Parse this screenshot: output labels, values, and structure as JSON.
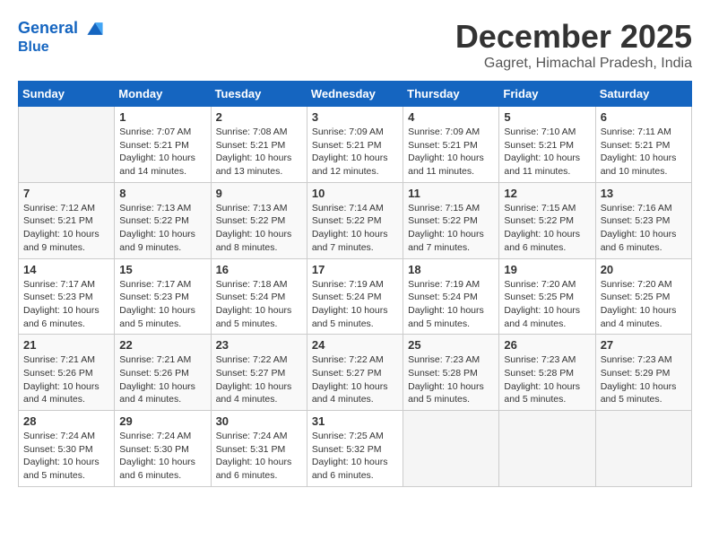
{
  "header": {
    "logo_line1": "General",
    "logo_line2": "Blue",
    "month": "December 2025",
    "location": "Gagret, Himachal Pradesh, India"
  },
  "weekdays": [
    "Sunday",
    "Monday",
    "Tuesday",
    "Wednesday",
    "Thursday",
    "Friday",
    "Saturday"
  ],
  "weeks": [
    [
      {
        "day": "",
        "empty": true
      },
      {
        "day": "1",
        "sunrise": "7:07 AM",
        "sunset": "5:21 PM",
        "daylight": "10 hours and 14 minutes."
      },
      {
        "day": "2",
        "sunrise": "7:08 AM",
        "sunset": "5:21 PM",
        "daylight": "10 hours and 13 minutes."
      },
      {
        "day": "3",
        "sunrise": "7:09 AM",
        "sunset": "5:21 PM",
        "daylight": "10 hours and 12 minutes."
      },
      {
        "day": "4",
        "sunrise": "7:09 AM",
        "sunset": "5:21 PM",
        "daylight": "10 hours and 11 minutes."
      },
      {
        "day": "5",
        "sunrise": "7:10 AM",
        "sunset": "5:21 PM",
        "daylight": "10 hours and 11 minutes."
      },
      {
        "day": "6",
        "sunrise": "7:11 AM",
        "sunset": "5:21 PM",
        "daylight": "10 hours and 10 minutes."
      }
    ],
    [
      {
        "day": "7",
        "sunrise": "7:12 AM",
        "sunset": "5:21 PM",
        "daylight": "10 hours and 9 minutes."
      },
      {
        "day": "8",
        "sunrise": "7:13 AM",
        "sunset": "5:22 PM",
        "daylight": "10 hours and 9 minutes."
      },
      {
        "day": "9",
        "sunrise": "7:13 AM",
        "sunset": "5:22 PM",
        "daylight": "10 hours and 8 minutes."
      },
      {
        "day": "10",
        "sunrise": "7:14 AM",
        "sunset": "5:22 PM",
        "daylight": "10 hours and 7 minutes."
      },
      {
        "day": "11",
        "sunrise": "7:15 AM",
        "sunset": "5:22 PM",
        "daylight": "10 hours and 7 minutes."
      },
      {
        "day": "12",
        "sunrise": "7:15 AM",
        "sunset": "5:22 PM",
        "daylight": "10 hours and 6 minutes."
      },
      {
        "day": "13",
        "sunrise": "7:16 AM",
        "sunset": "5:23 PM",
        "daylight": "10 hours and 6 minutes."
      }
    ],
    [
      {
        "day": "14",
        "sunrise": "7:17 AM",
        "sunset": "5:23 PM",
        "daylight": "10 hours and 6 minutes."
      },
      {
        "day": "15",
        "sunrise": "7:17 AM",
        "sunset": "5:23 PM",
        "daylight": "10 hours and 5 minutes."
      },
      {
        "day": "16",
        "sunrise": "7:18 AM",
        "sunset": "5:24 PM",
        "daylight": "10 hours and 5 minutes."
      },
      {
        "day": "17",
        "sunrise": "7:19 AM",
        "sunset": "5:24 PM",
        "daylight": "10 hours and 5 minutes."
      },
      {
        "day": "18",
        "sunrise": "7:19 AM",
        "sunset": "5:24 PM",
        "daylight": "10 hours and 5 minutes."
      },
      {
        "day": "19",
        "sunrise": "7:20 AM",
        "sunset": "5:25 PM",
        "daylight": "10 hours and 4 minutes."
      },
      {
        "day": "20",
        "sunrise": "7:20 AM",
        "sunset": "5:25 PM",
        "daylight": "10 hours and 4 minutes."
      }
    ],
    [
      {
        "day": "21",
        "sunrise": "7:21 AM",
        "sunset": "5:26 PM",
        "daylight": "10 hours and 4 minutes."
      },
      {
        "day": "22",
        "sunrise": "7:21 AM",
        "sunset": "5:26 PM",
        "daylight": "10 hours and 4 minutes."
      },
      {
        "day": "23",
        "sunrise": "7:22 AM",
        "sunset": "5:27 PM",
        "daylight": "10 hours and 4 minutes."
      },
      {
        "day": "24",
        "sunrise": "7:22 AM",
        "sunset": "5:27 PM",
        "daylight": "10 hours and 4 minutes."
      },
      {
        "day": "25",
        "sunrise": "7:23 AM",
        "sunset": "5:28 PM",
        "daylight": "10 hours and 5 minutes."
      },
      {
        "day": "26",
        "sunrise": "7:23 AM",
        "sunset": "5:28 PM",
        "daylight": "10 hours and 5 minutes."
      },
      {
        "day": "27",
        "sunrise": "7:23 AM",
        "sunset": "5:29 PM",
        "daylight": "10 hours and 5 minutes."
      }
    ],
    [
      {
        "day": "28",
        "sunrise": "7:24 AM",
        "sunset": "5:30 PM",
        "daylight": "10 hours and 5 minutes."
      },
      {
        "day": "29",
        "sunrise": "7:24 AM",
        "sunset": "5:30 PM",
        "daylight": "10 hours and 6 minutes."
      },
      {
        "day": "30",
        "sunrise": "7:24 AM",
        "sunset": "5:31 PM",
        "daylight": "10 hours and 6 minutes."
      },
      {
        "day": "31",
        "sunrise": "7:25 AM",
        "sunset": "5:32 PM",
        "daylight": "10 hours and 6 minutes."
      },
      {
        "day": "",
        "empty": true
      },
      {
        "day": "",
        "empty": true
      },
      {
        "day": "",
        "empty": true
      }
    ]
  ],
  "labels": {
    "sunrise": "Sunrise:",
    "sunset": "Sunset:",
    "daylight": "Daylight:"
  }
}
